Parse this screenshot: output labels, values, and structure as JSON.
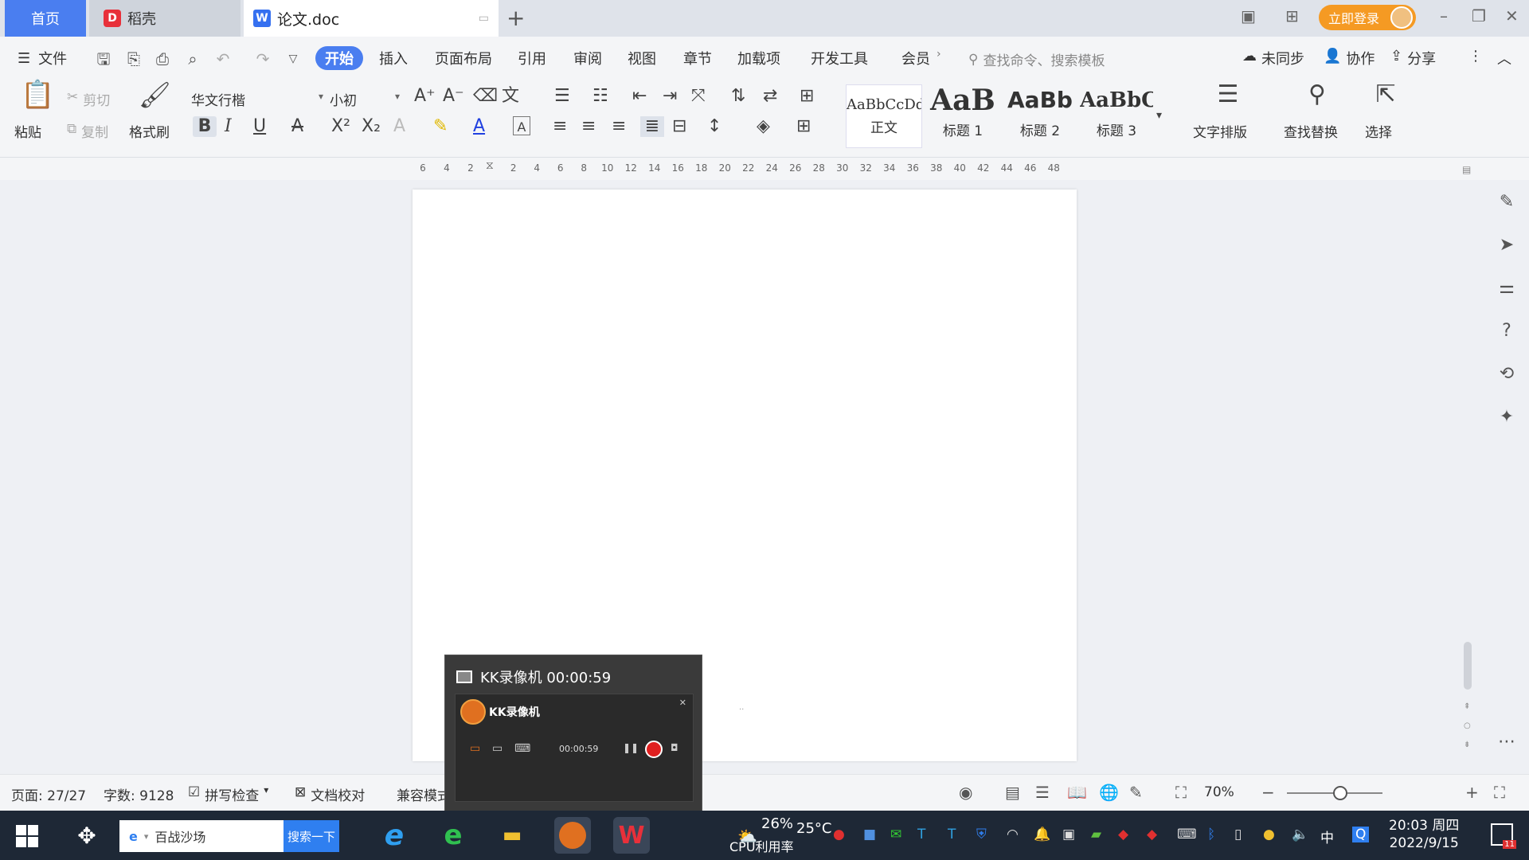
{
  "tabs": {
    "home": "首页",
    "daoke": "稻壳",
    "doc": "论文.doc",
    "add": "+"
  },
  "titlebar": {
    "login": "立即登录"
  },
  "menubar": {
    "file": "文件",
    "items": [
      "开始",
      "插入",
      "页面布局",
      "引用",
      "审阅",
      "视图",
      "章节",
      "加载项",
      "开发工具",
      "会员"
    ],
    "search_placeholder": "查找命令、搜索模板",
    "unsynced": "未同步",
    "collab": "协作",
    "share": "分享"
  },
  "ribbon": {
    "paste": "粘贴",
    "cut": "剪切",
    "copy": "复制",
    "format_painter": "格式刷",
    "font_name": "华文行楷",
    "font_size": "小初",
    "styles": [
      {
        "sample": "AaBbCcDd",
        "label": "正文"
      },
      {
        "sample": "AaB",
        "label": "标题 1"
      },
      {
        "sample": "AaBb",
        "label": "标题 2"
      },
      {
        "sample": "AaBbC",
        "label": "标题 3"
      }
    ],
    "text_layout": "文字排版",
    "find_replace": "查找替换",
    "select": "选择"
  },
  "ruler": {
    "left_numbers": [
      "6",
      "4",
      "2"
    ],
    "numbers": [
      "2",
      "4",
      "6",
      "8",
      "10",
      "12",
      "14",
      "16",
      "18",
      "20",
      "22",
      "24",
      "26",
      "28",
      "30",
      "32",
      "34",
      "36",
      "38",
      "40",
      "42",
      "44",
      "46",
      "48"
    ]
  },
  "kk_popup": {
    "title": "KK录像机 00:00:59",
    "app_name": "KK录像机",
    "time": "00:00:59"
  },
  "statusbar": {
    "page": "页面: 27/27",
    "words": "字数: 9128",
    "spellcheck": "拼写检查",
    "doc_check": "文档校对",
    "compat": "兼容模式",
    "zoom": "70%"
  },
  "taskbar": {
    "search_text": "百战沙场",
    "search_button": "搜索一下",
    "weather": "26%",
    "temp": "25°C",
    "cpu": "CPU利用率",
    "ime": "中",
    "time": "20:03 周四",
    "date": "2022/9/15",
    "notif_count": "11"
  }
}
